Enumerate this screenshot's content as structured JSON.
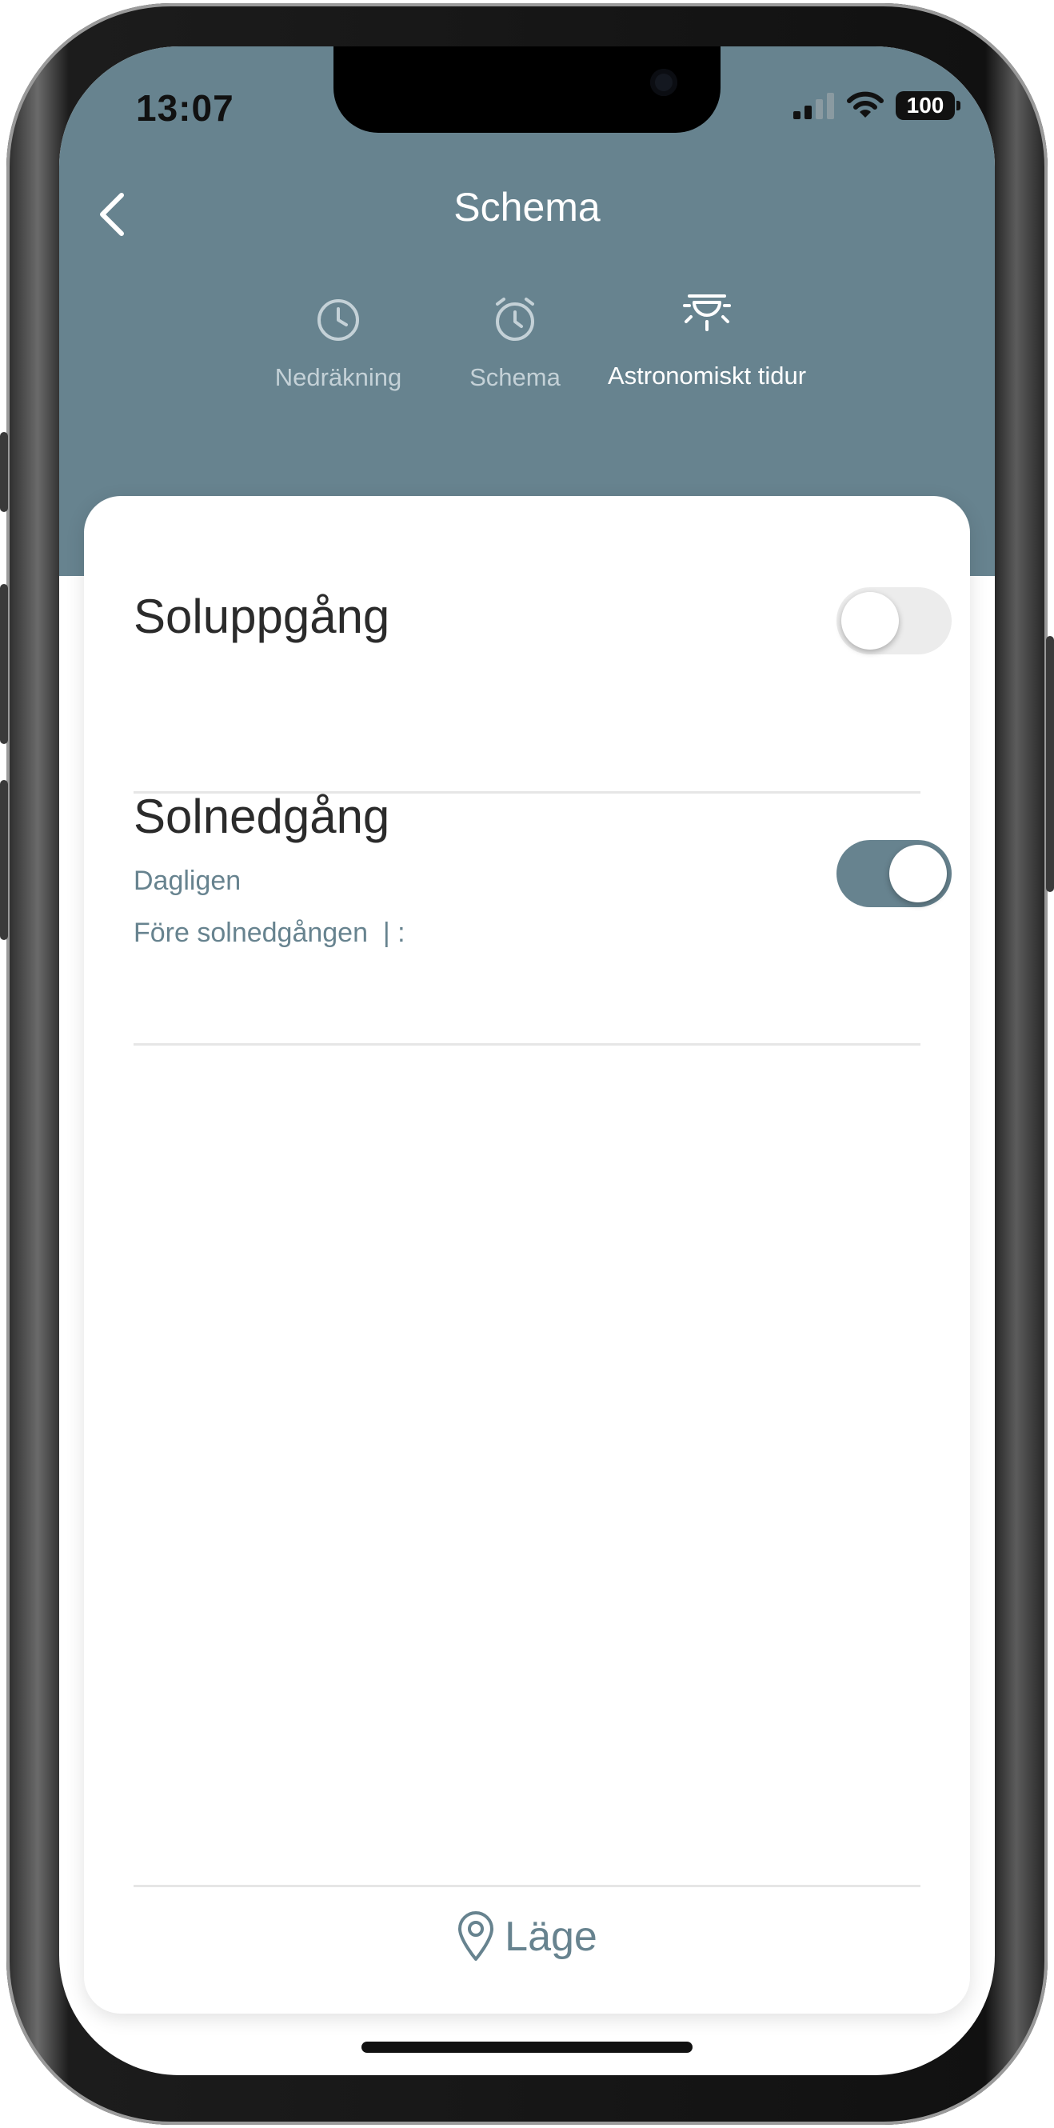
{
  "status_bar": {
    "time": "13:07",
    "battery": "100"
  },
  "header": {
    "title": "Schema",
    "back_icon": "chevron-left-icon"
  },
  "tabs": [
    {
      "label": "Nedräkning",
      "icon": "clock-icon",
      "active": false
    },
    {
      "label": "Schema",
      "icon": "alarm-clock-icon",
      "active": false
    },
    {
      "label": "Astronomiskt tidur",
      "icon": "sun-horizon-icon",
      "active": true
    }
  ],
  "rows": [
    {
      "title": "Soluppgång",
      "enabled": false
    },
    {
      "title": "Solnedgång",
      "repeat": "Dagligen",
      "detail": "Före solnedgången  | :",
      "enabled": true
    }
  ],
  "footer": {
    "location_label": "Läge",
    "location_icon": "location-pin-icon"
  },
  "colors": {
    "accent": "#67838f",
    "toggle_off": "#ececec",
    "background": "#ffffff"
  }
}
